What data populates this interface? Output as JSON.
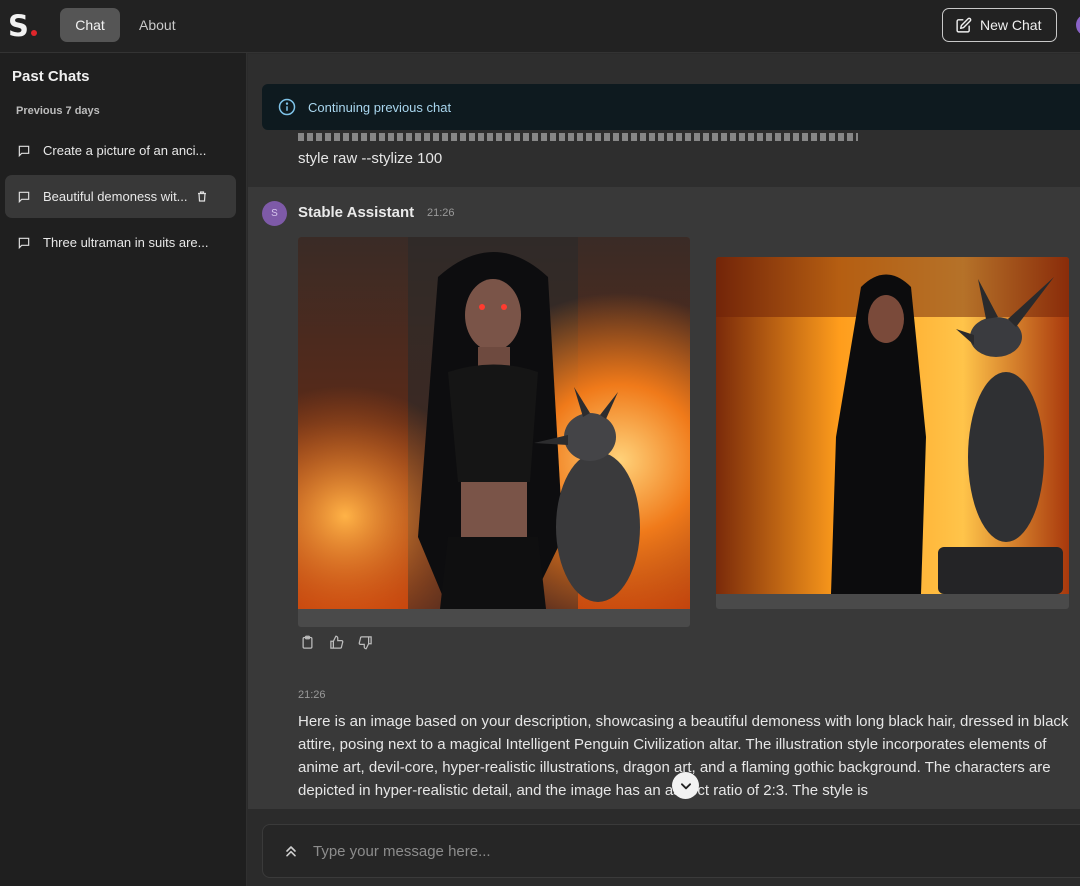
{
  "brand": {
    "logo_text": "S",
    "dot_color": "#e0262b"
  },
  "nav": {
    "tabs": [
      {
        "label": "Chat",
        "active": true
      },
      {
        "label": "About",
        "active": false
      }
    ]
  },
  "header": {
    "new_chat_label": "New Chat"
  },
  "sidebar": {
    "title": "Past Chats",
    "section_label": "Previous 7 days",
    "items": [
      {
        "label": "Create a picture of an anci...",
        "active": false
      },
      {
        "label": "Beautiful demoness wit...",
        "active": true
      },
      {
        "label": "Three ultraman in suits are...",
        "active": false
      }
    ]
  },
  "notice": {
    "text": "Continuing previous chat",
    "icon": "info-icon"
  },
  "previous_message": {
    "text_tail": "style raw --stylize 100"
  },
  "assistant": {
    "avatar_letter": "S",
    "name": "Stable Assistant",
    "time": "21:26",
    "images": [
      {
        "alt": "generated-image-1"
      },
      {
        "alt": "generated-image-2"
      }
    ],
    "actions": [
      "clipboard-icon",
      "thumbs-up-icon",
      "thumbs-down-icon"
    ],
    "message_time": "21:26",
    "message_text": "Here is an image based on your description, showcasing a beautiful demoness with long black hair, dressed in black attire, posing next to a magical Intelligent Penguin Civilization altar. The illustration style incorporates elements of anime art, devil-core, hyper-realistic illustrations, dragon art, and a flaming gothic background. The characters are depicted in hyper-realistic detail, and the image has an aspect ratio of 2:3. The style is"
  },
  "composer": {
    "placeholder": "Type your message here..."
  },
  "colors": {
    "accent_purple": "#7e5aa8",
    "notice_text": "#a9d6ee",
    "active_tab": "#555555"
  }
}
